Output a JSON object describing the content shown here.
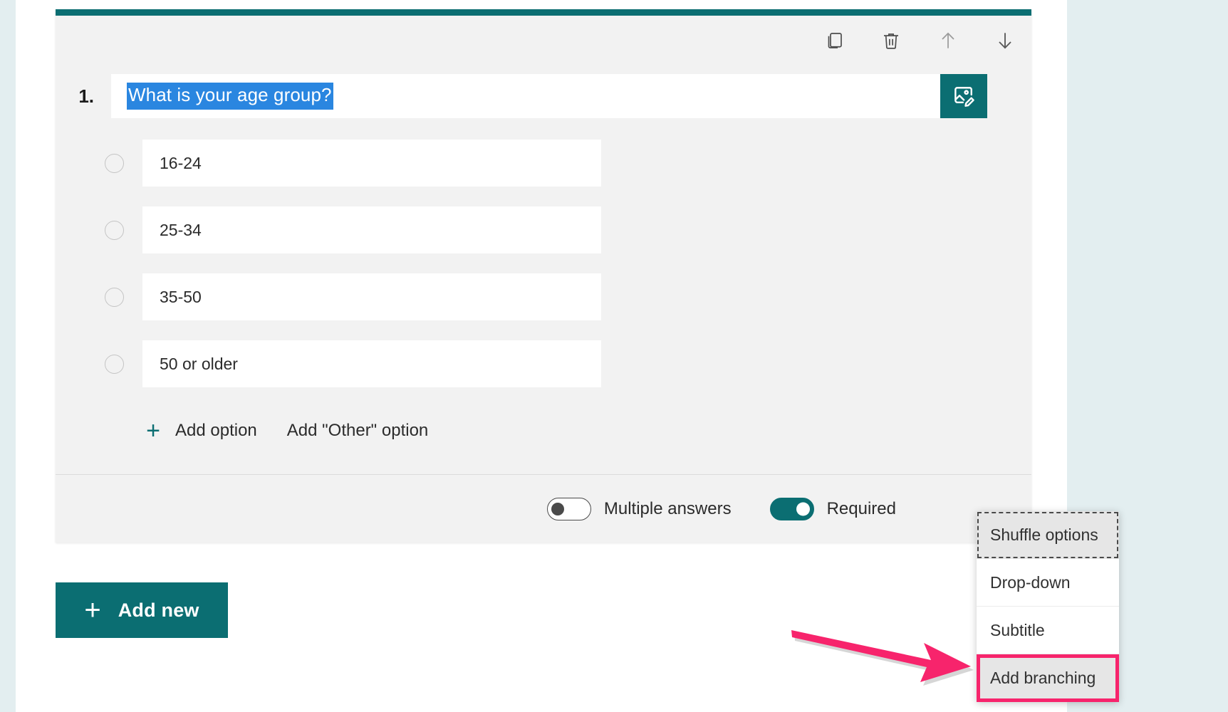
{
  "theme": {
    "accent_teal": "#0b6e72",
    "selection_blue": "#2a86e0",
    "annotation_pink": "#f7246c",
    "card_bg": "#f2f2f2",
    "page_bg": "#e3eef0"
  },
  "card": {
    "toolbar": [
      {
        "name": "copy-question-button",
        "icon": "copy-icon",
        "label": "Copy question"
      },
      {
        "name": "delete-question-button",
        "icon": "trash-icon",
        "label": "Delete question"
      },
      {
        "name": "move-question-up-button",
        "icon": "arrow-up-icon",
        "label": "Move up"
      },
      {
        "name": "move-question-down-button",
        "icon": "arrow-down-icon",
        "label": "Move down"
      }
    ],
    "question": {
      "number": "1.",
      "title": "What is your age group?",
      "title_selected": true,
      "media_button_label": "Insert media",
      "media_button_icon": "image-edit-icon"
    },
    "options": [
      {
        "label": "16-24"
      },
      {
        "label": "25-34"
      },
      {
        "label": "35-50"
      },
      {
        "label": "50 or older"
      }
    ],
    "add_option_label": "Add option",
    "add_option_icon": "plus-icon",
    "add_other_option_label": "Add \"Other\" option",
    "footer": {
      "multiple_answers": {
        "label": "Multiple answers",
        "on": false
      },
      "required": {
        "label": "Required",
        "on": true
      }
    }
  },
  "add_new": {
    "label": "Add new",
    "icon": "plus-icon"
  },
  "context_menu": {
    "items": [
      {
        "label": "Shuffle options",
        "state": "focused"
      },
      {
        "label": "Drop-down",
        "state": "normal"
      },
      {
        "label": "Subtitle",
        "state": "normal"
      },
      {
        "label": "Add branching",
        "state": "highlighted"
      }
    ]
  },
  "annotation": {
    "arrow_target": "Add branching",
    "arrow_color": "#f7246c"
  }
}
